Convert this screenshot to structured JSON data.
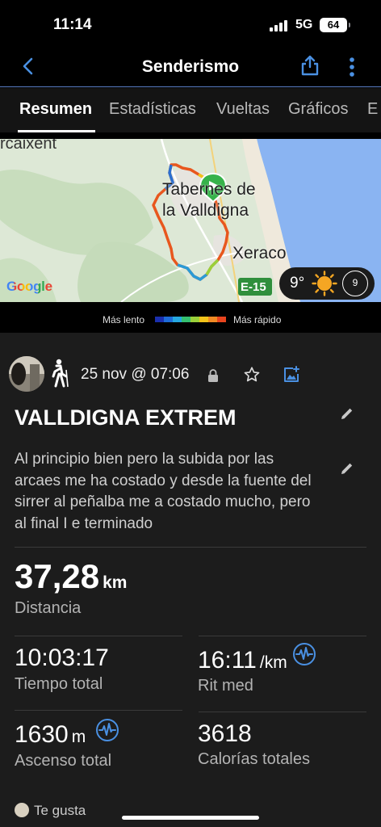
{
  "status_bar": {
    "time": "11:14",
    "network": "5G",
    "battery": "64"
  },
  "nav": {
    "title": "Senderismo",
    "back_icon": "chevron-left-icon",
    "share_icon": "share-icon",
    "more_icon": "more-vertical-icon"
  },
  "tabs": [
    {
      "label": "Resumen",
      "active": true
    },
    {
      "label": "Estadísticas",
      "active": false
    },
    {
      "label": "Vueltas",
      "active": false
    },
    {
      "label": "Gráficos",
      "active": false
    },
    {
      "label": "E",
      "active": false
    }
  ],
  "map": {
    "labels": {
      "top_left": "rcaixent",
      "town1_line1": "Tabernes de",
      "town1_line2": "la Valldigna",
      "town2": "Xeraco",
      "road": "E-15"
    },
    "attribution": "Google",
    "weather": {
      "temperature": "9°",
      "wind": "9"
    }
  },
  "pace_legend": {
    "slow_label": "Más lento",
    "fast_label": "Más rápido",
    "colors": [
      "#1a2fae",
      "#1e6cd8",
      "#26a8e0",
      "#35c070",
      "#9ad03a",
      "#f2c31a",
      "#f08a24",
      "#e8441e"
    ]
  },
  "activity": {
    "date": "25 nov @ 07:06",
    "title": "VALLDIGNA EXTREM",
    "description": "Al principio bien pero la subida por las arcaes me ha costado y desde la fuente del sirrer al peñalba me a costado mucho, pero al final I e terminado"
  },
  "stats": {
    "distance": {
      "value": "37,28",
      "unit": "km",
      "label": "Distancia"
    },
    "total_time": {
      "value": "10:03:17",
      "label": "Tiempo total"
    },
    "avg_pace": {
      "value": "16:11",
      "unit": "/km",
      "label": "Rit med"
    },
    "total_ascent": {
      "value": "1630",
      "unit": "m",
      "label": "Ascenso total"
    },
    "total_calories": {
      "value": "3618",
      "label": "Calorías totales"
    }
  },
  "social": {
    "likes_label": "Te gusta"
  },
  "colors": {
    "accent_blue": "#4a90e2",
    "background": "#000000",
    "panel": "#1c1c1c",
    "divider": "#3a3a3a"
  }
}
